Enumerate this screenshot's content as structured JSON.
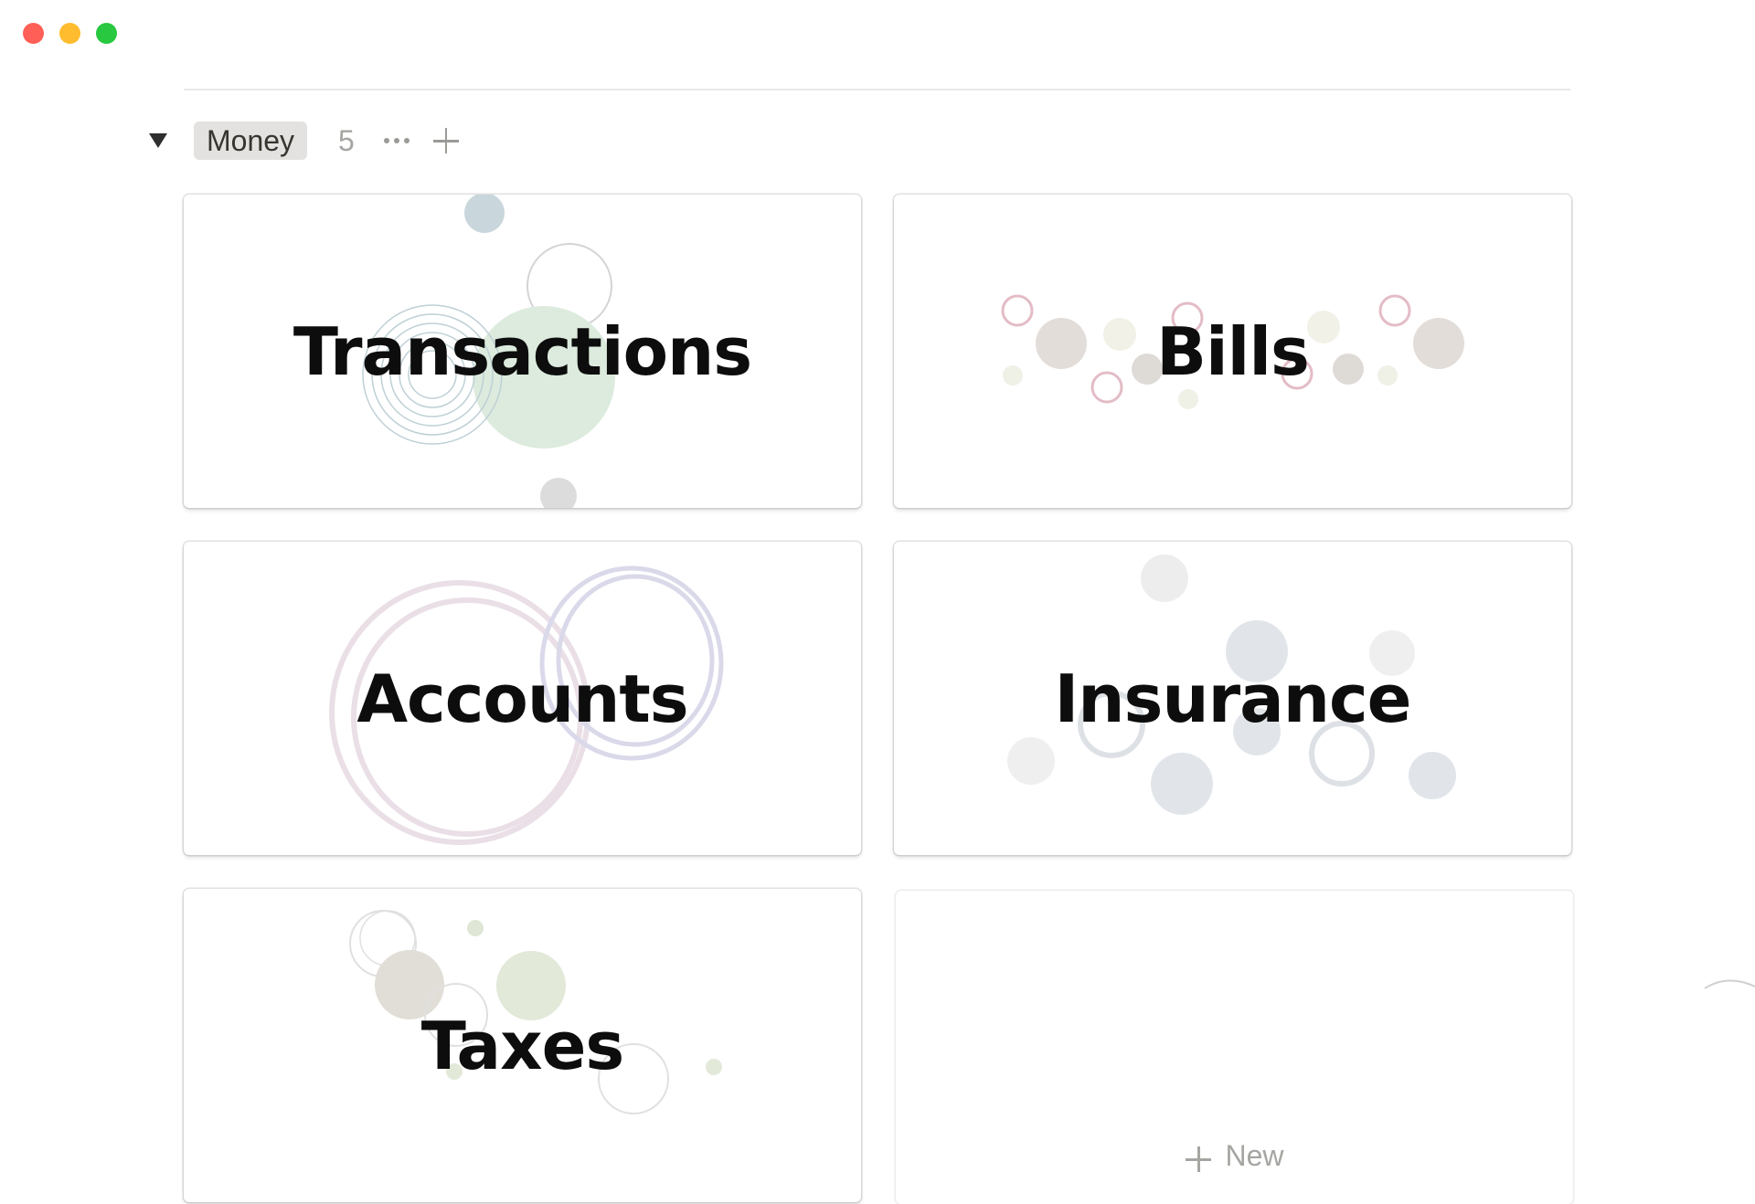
{
  "window": {
    "controls": [
      "close",
      "minimize",
      "maximize"
    ]
  },
  "group": {
    "name": "Money",
    "count": "5"
  },
  "cards": [
    {
      "title": "Transactions"
    },
    {
      "title": "Bills"
    },
    {
      "title": "Accounts"
    },
    {
      "title": "Insurance"
    },
    {
      "title": "Taxes"
    }
  ],
  "new_card": {
    "label": "New"
  },
  "colors": {
    "tag_bg": "#e3e2e0",
    "muted": "#a5a5a2",
    "title": "#0d0d0d"
  }
}
